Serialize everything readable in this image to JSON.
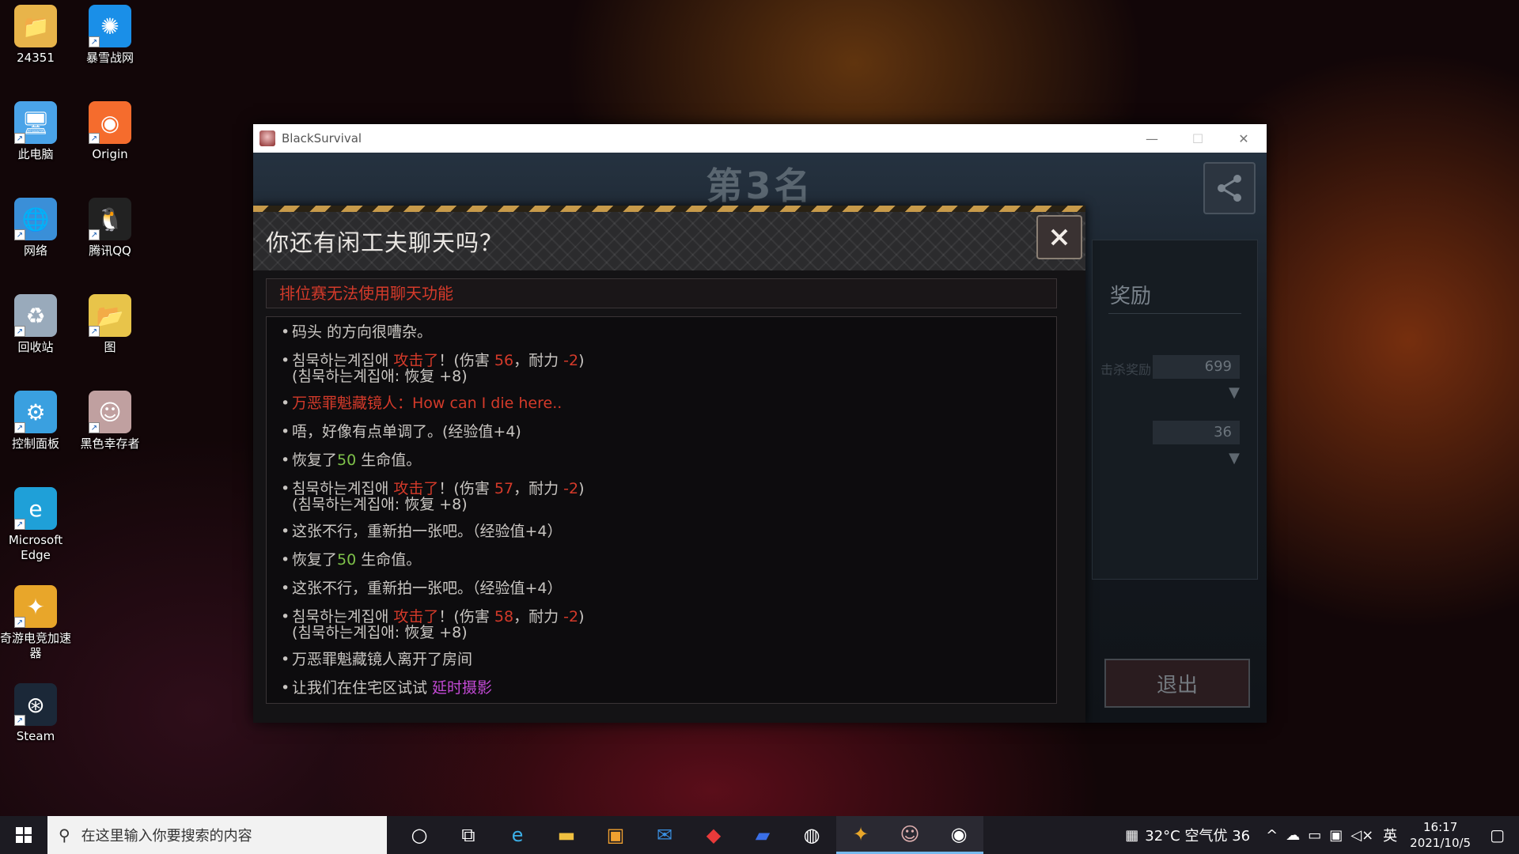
{
  "desktop": {
    "icons": [
      {
        "label": "24351",
        "icon": "user-folder-icon",
        "color": "#e8b44a"
      },
      {
        "label": "暴雪战网",
        "icon": "battlenet-icon",
        "color": "#1a8fe8"
      },
      {
        "label": "此电脑",
        "icon": "computer-icon",
        "color": "#4aa3e8"
      },
      {
        "label": "Origin",
        "icon": "origin-icon",
        "color": "#f56c2d"
      },
      {
        "label": "网络",
        "icon": "network-icon",
        "color": "#3a8fd8"
      },
      {
        "label": "腾讯QQ",
        "icon": "qq-icon",
        "color": "#222222"
      },
      {
        "label": "回收站",
        "icon": "recycle-bin-icon",
        "color": "#9ab"
      },
      {
        "label": "图",
        "icon": "folder-icon",
        "color": "#e8c44a"
      },
      {
        "label": "控制面板",
        "icon": "control-panel-icon",
        "color": "#3aa0e0"
      },
      {
        "label": "黑色幸存者",
        "icon": "black-survival-icon",
        "color": "#c0a0a0"
      },
      {
        "label": "Microsoft Edge",
        "icon": "edge-icon",
        "color": "#1fa0d8"
      },
      {
        "label": "奇游电竞加速器",
        "icon": "qiyou-icon",
        "color": "#e8a62a"
      },
      {
        "label": "Steam",
        "icon": "steam-icon",
        "color": "#1b2838"
      }
    ]
  },
  "window": {
    "title": "BlackSurvival",
    "minimize": "—",
    "maximize": "☐",
    "close": "✕"
  },
  "game": {
    "rank_title": "第3名",
    "reward_title": "奖励",
    "reward_value_1": "699",
    "reward_value_2": "36",
    "faint_label_1": "击杀奖励",
    "exit_label": "退出"
  },
  "modal": {
    "title": "你还有闲工夫聊天吗？",
    "notice": "排位赛无法使用聊天功能",
    "chat": [
      {
        "segments": [
          {
            "t": "码头 的方向很嘈杂。",
            "c": ""
          }
        ]
      },
      {
        "segments": [
          {
            "t": "침묵하는계집애 ",
            "c": ""
          },
          {
            "t": "攻击了",
            "c": "red"
          },
          {
            "t": "！(伤害 ",
            "c": ""
          },
          {
            "t": "56",
            "c": "red"
          },
          {
            "t": "，耐力 ",
            "c": ""
          },
          {
            "t": "-2",
            "c": "red"
          },
          {
            "t": ")",
            "c": ""
          }
        ],
        "sub": "(침묵하는계집애: 恢复 +8)"
      },
      {
        "segments": [
          {
            "t": "万恶罪魁藏镜人：How can I die here..",
            "c": "red"
          }
        ]
      },
      {
        "segments": [
          {
            "t": "唔，好像有点单调了。(经验值+4)",
            "c": ""
          }
        ]
      },
      {
        "segments": [
          {
            "t": "恢复了",
            "c": ""
          },
          {
            "t": "50",
            "c": "green"
          },
          {
            "t": " 生命值。",
            "c": ""
          }
        ]
      },
      {
        "segments": [
          {
            "t": "침묵하는계집애 ",
            "c": ""
          },
          {
            "t": "攻击了",
            "c": "red"
          },
          {
            "t": "！(伤害 ",
            "c": ""
          },
          {
            "t": "57",
            "c": "red"
          },
          {
            "t": "，耐力 ",
            "c": ""
          },
          {
            "t": "-2",
            "c": "red"
          },
          {
            "t": ")",
            "c": ""
          }
        ],
        "sub": "(침묵하는계집애: 恢复 +8)"
      },
      {
        "segments": [
          {
            "t": "这张不行，重新拍一张吧。（经验值+4）",
            "c": ""
          }
        ]
      },
      {
        "segments": [
          {
            "t": "恢复了",
            "c": ""
          },
          {
            "t": "50",
            "c": "green"
          },
          {
            "t": " 生命值。",
            "c": ""
          }
        ]
      },
      {
        "segments": [
          {
            "t": "这张不行，重新拍一张吧。（经验值+4）",
            "c": ""
          }
        ]
      },
      {
        "segments": [
          {
            "t": "침묵하는계집애 ",
            "c": ""
          },
          {
            "t": "攻击了",
            "c": "red"
          },
          {
            "t": "！(伤害 ",
            "c": ""
          },
          {
            "t": "58",
            "c": "red"
          },
          {
            "t": "，耐力 ",
            "c": ""
          },
          {
            "t": "-2",
            "c": "red"
          },
          {
            "t": ")",
            "c": ""
          }
        ],
        "sub": "(침묵하는계집애: 恢复 +8)"
      },
      {
        "segments": [
          {
            "t": "万恶罪魁藏镜人离开了房间",
            "c": ""
          }
        ]
      },
      {
        "segments": [
          {
            "t": "让我们在住宅区试试 ",
            "c": ""
          },
          {
            "t": "延时摄影",
            "c": "purple"
          }
        ]
      }
    ]
  },
  "taskbar": {
    "search_placeholder": "在这里输入你要搜索的内容",
    "weather": "32°C 空气优 36",
    "ime": "英",
    "time": "16:17",
    "date": "2021/10/5",
    "apps": [
      "cortana-icon",
      "task-view-icon",
      "edge-icon",
      "file-explorer-icon",
      "store-icon",
      "mail-icon",
      "app-red-icon",
      "app-blue-icon",
      "app-white-icon",
      "qiyou-icon",
      "black-survival-icon",
      "app-globe-icon"
    ]
  }
}
